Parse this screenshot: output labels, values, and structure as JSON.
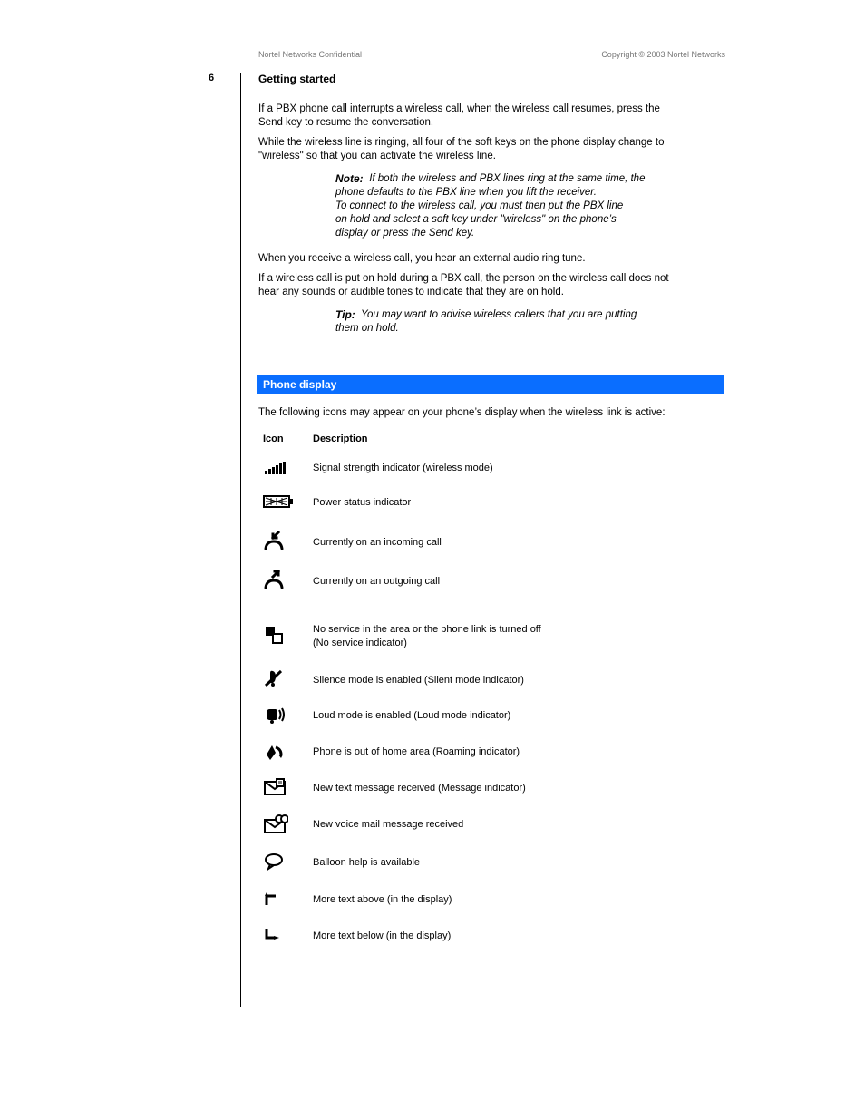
{
  "header": {
    "system": "Nortel Networks Confidential",
    "copyright": "Copyright © 2003 Nortel Networks"
  },
  "pageNumber": "6",
  "runningTitle": "Getting started",
  "body": {
    "intro1": "If a PBX phone call interrupts a wireless call, when the wireless call resumes, press the",
    "intro2": "Send key to resume the conversation.",
    "intro3": "While the wireless line is ringing, all four of the soft keys on the phone display change to",
    "intro4": "\"wireless\" so that you can activate the wireless line.",
    "note_label": "Note:",
    "note1": " If both the wireless and PBX lines ring at the same time, the",
    "note2": "phone defaults to the PBX line when you lift the receiver.",
    "note3": "To connect to the wireless call, you must then put the PBX line",
    "note4": "on hold and select a soft key under \"wireless\" on the phone’s",
    "note5": "display or press the Send key.",
    "audio_note": "When you receive a wireless call, you hear an external audio ring tune.",
    "hold_note1": "If a wireless call is put on hold during a PBX call, the person on the wireless call does not",
    "hold_note2": "hear any sounds or audible tones to indicate that they are on hold.",
    "tip_label": "Tip:",
    "tip1": " You may want to advise wireless callers that you are putting",
    "tip2": "them on hold."
  },
  "section_heading": "Phone display",
  "section_intro": "The following icons may appear on your phone’s display when the wireless link is active:",
  "table": {
    "col_icon": "Icon",
    "col_desc": "Description",
    "rows": [
      {
        "name": "signal-icon",
        "desc": "Signal strength indicator (wireless mode)"
      },
      {
        "name": "battery-icon",
        "desc": "Power status indicator"
      },
      {
        "name": "incoming-call-icon",
        "desc": "Currently on an incoming call"
      },
      {
        "name": "outgoing-call-icon",
        "desc": "Currently on an outgoing call"
      },
      {
        "name": "no-service-icon",
        "desc1": "No service in the area or the phone link is turned off",
        "desc2": "(No service indicator)"
      },
      {
        "name": "silent-mode-icon",
        "desc": "Silence mode is enabled (Silent mode indicator)"
      },
      {
        "name": "loud-mode-icon",
        "desc": "Loud mode is enabled (Loud mode indicator)"
      },
      {
        "name": "roaming-icon",
        "desc": "Phone is out of home area (Roaming indicator)"
      },
      {
        "name": "text-message-icon",
        "desc": "New text message received (Message indicator)"
      },
      {
        "name": "voicemail-icon",
        "desc": "New voice mail message received"
      },
      {
        "name": "balloon-icon",
        "desc": "Balloon help is available"
      },
      {
        "name": "text-more-up-icon",
        "desc": "More text above (in the display)"
      },
      {
        "name": "text-more-down-icon",
        "desc": "More text below (in the display)"
      }
    ]
  }
}
